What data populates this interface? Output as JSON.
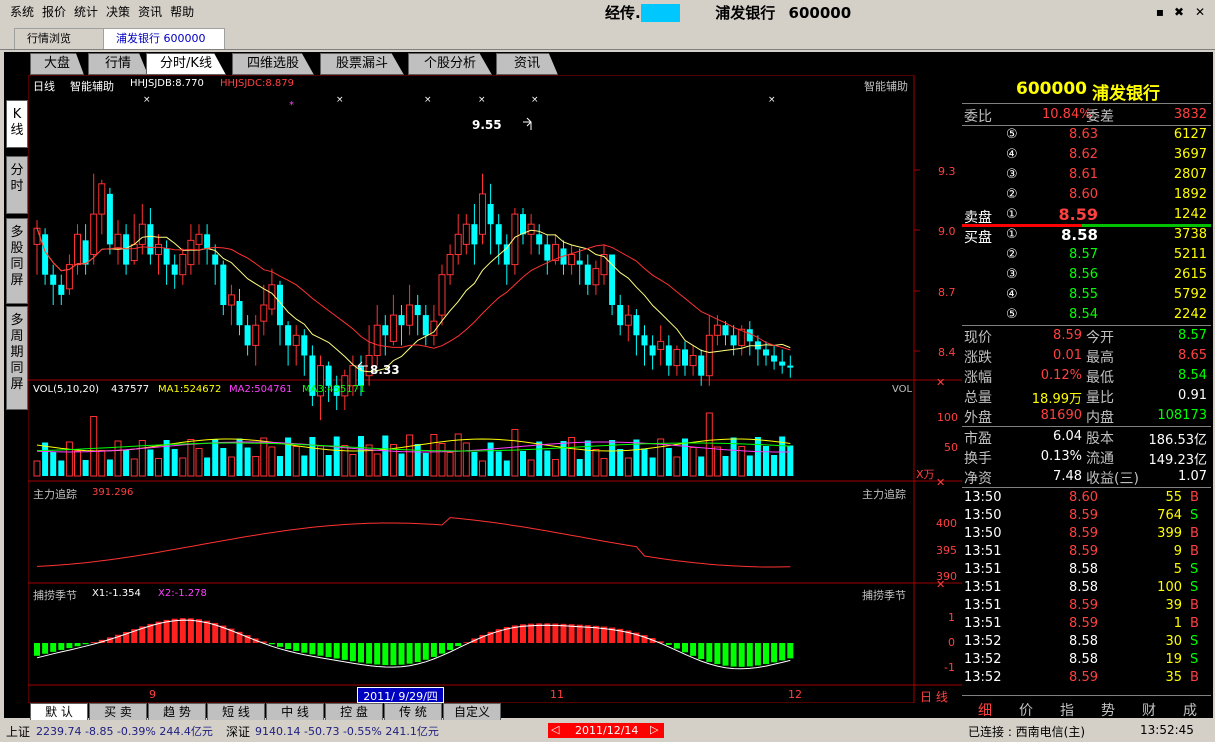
{
  "menu": [
    "系统",
    "报价",
    "统计",
    "决策",
    "资讯",
    "帮助"
  ],
  "title": {
    "prefix": "经传.",
    "highlight": "      ",
    "stock_name": "浦发银行",
    "code": "600000"
  },
  "window_buttons": [
    "▪",
    "✖",
    "✕"
  ],
  "doc_tabs": [
    "行情浏览",
    "浦发银行 600000"
  ],
  "top_tabs": [
    "大盘",
    "行情",
    "分时/K线",
    "四维选股",
    "股票漏斗",
    "个股分析",
    "资讯"
  ],
  "side_tabs": [
    "K\n线",
    "分\n时",
    "多\n股\n同\n屏",
    "多\n周\n期\n同\n屏"
  ],
  "chart_header": {
    "period": "日线",
    "indicator": "智能辅助",
    "i1": "HHJSJDB:8.770",
    "i2": "HHJSJDC:8.879",
    "right_label": "智能辅助"
  },
  "price_axis": [
    "9.3",
    "9.0",
    "8.7",
    "8.4"
  ],
  "annotations": {
    "high": "9.55",
    "low": "8.33"
  },
  "vol_header": {
    "label": "VOL(5,10,20)",
    "v": "437577",
    "ma1": "MA1:524672",
    "ma2": "MA2:504761",
    "ma3": "MA3:455171",
    "right": "VOL"
  },
  "vol_axis": [
    "100",
    "50"
  ],
  "vol_unit": "X万",
  "zl_header": {
    "label": "主力追踪",
    "value": "391.296",
    "right": "主力追踪"
  },
  "zl_axis": [
    "400",
    "395",
    "390"
  ],
  "bl_header": {
    "label": "捕捞季节",
    "x1": "X1:-1.354",
    "x2": "X2:-1.278",
    "right": "捕捞季节"
  },
  "bl_axis": [
    "1",
    "0",
    "-1"
  ],
  "x_axis": {
    "t1": "9",
    "date": "2011/ 9/29/四",
    "t2": "11",
    "t3": "12",
    "right": "日 线"
  },
  "bottom_tabs": [
    "默 认",
    "买 卖",
    "趋 势",
    "短 线",
    "中 线",
    "控 盘",
    "传 统",
    "自定义"
  ],
  "quote": {
    "code": "600000",
    "name": "浦发银行",
    "weibi_label": "委比",
    "weibi": "10.84%",
    "weicha_label": "委差",
    "weicha": "3832",
    "sell_label": "卖盘",
    "buy_label": "买盘",
    "asks": [
      {
        "lvl": "⑤",
        "price": "8.63",
        "vol": "6127"
      },
      {
        "lvl": "④",
        "price": "8.62",
        "vol": "3697"
      },
      {
        "lvl": "③",
        "price": "8.61",
        "vol": "2807"
      },
      {
        "lvl": "②",
        "price": "8.60",
        "vol": "1892"
      },
      {
        "lvl": "①",
        "price": "8.59",
        "vol": "1242"
      }
    ],
    "bids": [
      {
        "lvl": "①",
        "price": "8.58",
        "vol": "3738"
      },
      {
        "lvl": "②",
        "price": "8.57",
        "vol": "5211"
      },
      {
        "lvl": "③",
        "price": "8.56",
        "vol": "2615"
      },
      {
        "lvl": "④",
        "price": "8.55",
        "vol": "5792"
      },
      {
        "lvl": "⑤",
        "price": "8.54",
        "vol": "2242"
      }
    ],
    "stats": [
      {
        "l1": "现价",
        "v1": "8.59",
        "c1": "#ff4040",
        "l2": "今开",
        "v2": "8.57",
        "c2": "#00ff00"
      },
      {
        "l1": "涨跌",
        "v1": "0.01",
        "c1": "#ff4040",
        "l2": "最高",
        "v2": "8.65",
        "c2": "#ff4040"
      },
      {
        "l1": "涨幅",
        "v1": "0.12%",
        "c1": "#ff4040",
        "l2": "最低",
        "v2": "8.54",
        "c2": "#00ff00"
      },
      {
        "l1": "总量",
        "v1": "18.99万",
        "c1": "#ffff00",
        "l2": "量比",
        "v2": "0.91",
        "c2": "#ffffff"
      },
      {
        "l1": "外盘",
        "v1": "81690",
        "c1": "#ff4040",
        "l2": "内盘",
        "v2": "108173",
        "c2": "#00ff00"
      },
      {
        "l1": "市盈",
        "v1": "6.04",
        "c1": "#ffffff",
        "l2": "股本",
        "v2": "186.53亿",
        "c2": "#ffffff"
      },
      {
        "l1": "换手",
        "v1": "0.13%",
        "c1": "#ffffff",
        "l2": "流通",
        "v2": "149.23亿",
        "c2": "#ffffff"
      },
      {
        "l1": "净资",
        "v1": "7.48",
        "c1": "#ffffff",
        "l2": "收益(三)",
        "v2": "1.07",
        "c2": "#ffffff"
      }
    ],
    "ticks": [
      {
        "t": "13:50",
        "p": "8.60",
        "pc": "#ff4040",
        "v": "55",
        "bs": "B"
      },
      {
        "t": "13:50",
        "p": "8.59",
        "pc": "#ff4040",
        "v": "764",
        "bs": "S"
      },
      {
        "t": "13:50",
        "p": "8.59",
        "pc": "#ff4040",
        "v": "399",
        "bs": "B"
      },
      {
        "t": "13:51",
        "p": "8.59",
        "pc": "#ff4040",
        "v": "9",
        "bs": "B"
      },
      {
        "t": "13:51",
        "p": "8.58",
        "pc": "#ffffff",
        "v": "5",
        "bs": "S"
      },
      {
        "t": "13:51",
        "p": "8.58",
        "pc": "#ffffff",
        "v": "100",
        "bs": "S"
      },
      {
        "t": "13:51",
        "p": "8.59",
        "pc": "#ff4040",
        "v": "39",
        "bs": "B"
      },
      {
        "t": "13:51",
        "p": "8.59",
        "pc": "#ff4040",
        "v": "1",
        "bs": "B"
      },
      {
        "t": "13:52",
        "p": "8.58",
        "pc": "#ffffff",
        "v": "30",
        "bs": "S"
      },
      {
        "t": "13:52",
        "p": "8.58",
        "pc": "#ffffff",
        "v": "19",
        "bs": "S"
      },
      {
        "t": "13:52",
        "p": "8.59",
        "pc": "#ff4040",
        "v": "35",
        "bs": "B"
      }
    ],
    "panel_tabs": [
      "细",
      "价",
      "指",
      "势",
      "财",
      "成"
    ]
  },
  "status": {
    "sh_label": "上证",
    "sh": "2239.74  -8.85  -0.39%  244.4亿元",
    "sz_label": "深证",
    "sz": "9140.14  -50.73  -0.55%  241.1亿元",
    "date": "2011/12/14",
    "prev": "◁",
    "next": "▷",
    "conn": "已连接 : 西南电信(主)",
    "time": "13:52:45"
  }
}
